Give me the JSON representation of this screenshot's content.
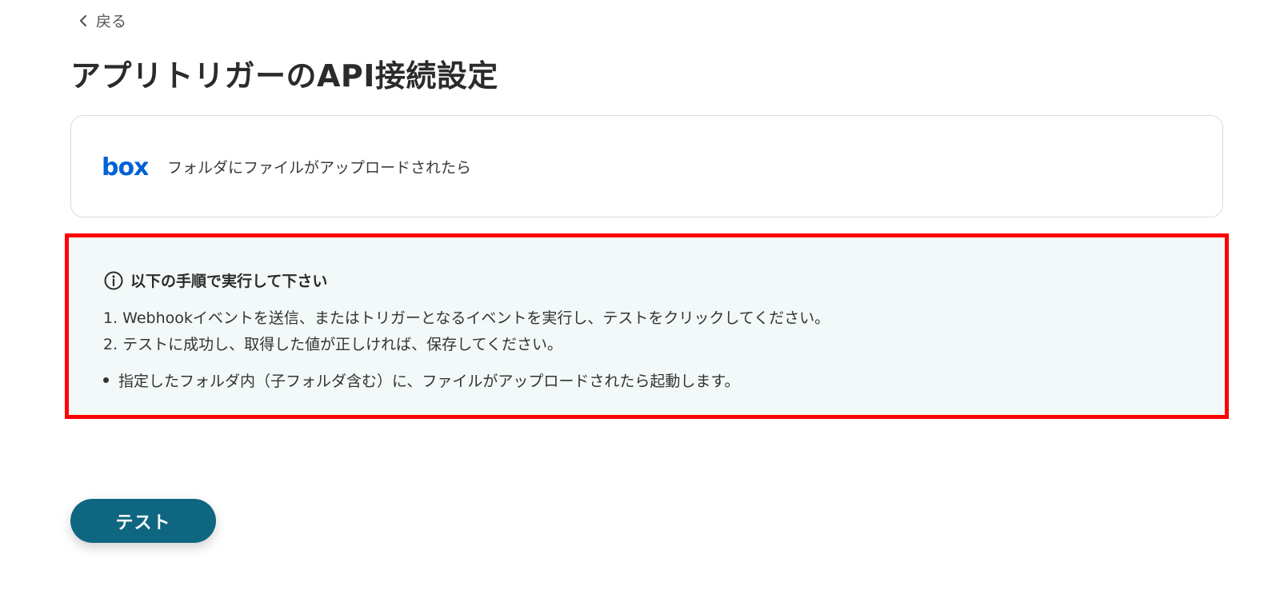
{
  "nav": {
    "back_label": "戻る",
    "back_icon": "chevron-left-icon"
  },
  "page": {
    "title": "アプリトリガーのAPI接続設定"
  },
  "trigger": {
    "app_logo_text": "box",
    "app_logo_color": "#0061d5",
    "label": "フォルダにファイルがアップロードされたら"
  },
  "instructions": {
    "icon": "info-icon",
    "title": "以下の手順で実行して下さい",
    "steps": [
      "1. Webhookイベントを送信、またはトリガーとなるイベントを実行し、テストをクリックしてください。",
      "2. テストに成功し、取得した値が正しければ、保存してください。"
    ],
    "notes": [
      "指定したフォルダ内（子フォルダ含む）に、ファイルがアップロードされたら起動します。"
    ],
    "highlight_border_color": "#ff0000",
    "background_color": "#f2f9f8"
  },
  "actions": {
    "test_label": "テスト",
    "test_color": "#0f6680"
  }
}
